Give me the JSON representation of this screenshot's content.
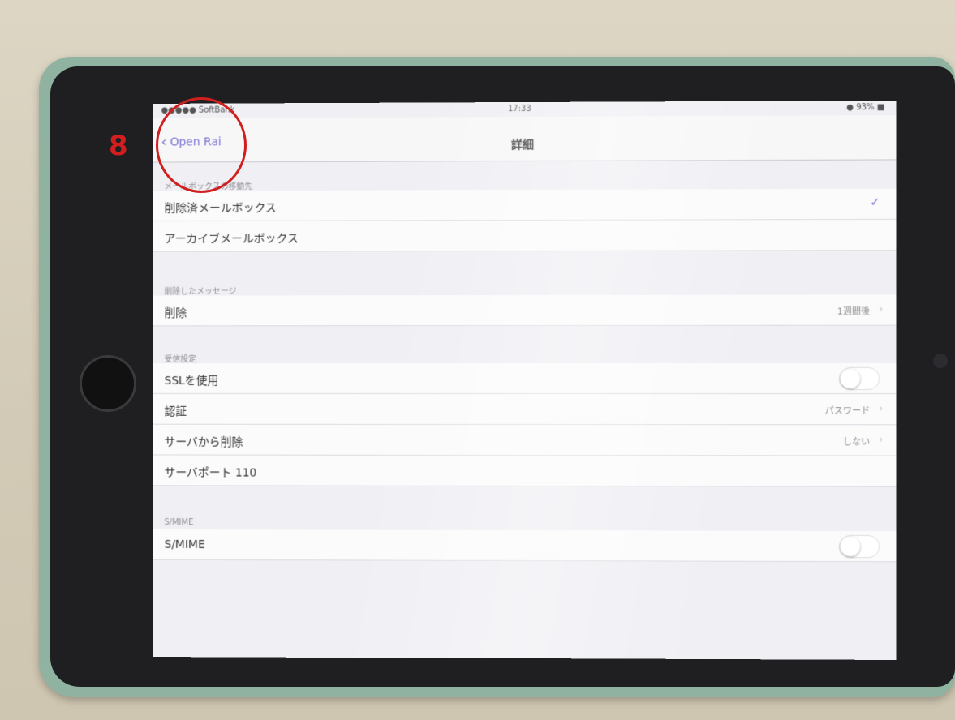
{
  "status_bar": {
    "carrier": "●●●●● SoftBank",
    "time": "17:33",
    "battery": "● 93% ■"
  },
  "nav": {
    "back_label": "Open Rai",
    "title": "詳細"
  },
  "sections": [
    {
      "header": "メールボックスの移動先",
      "rows": [
        {
          "label": "削除済メールボックス",
          "accessory": "check"
        },
        {
          "label": "アーカイブメールボックス",
          "accessory": "none"
        }
      ]
    },
    {
      "header": "削除したメッセージ",
      "rows": [
        {
          "label": "削除",
          "value": "1週間後",
          "accessory": "chevron"
        }
      ]
    },
    {
      "header": "受信設定",
      "rows": [
        {
          "label": "SSLを使用",
          "accessory": "toggle-off"
        },
        {
          "label": "認証",
          "value": "パスワード",
          "accessory": "chevron"
        },
        {
          "label": "サーバから削除",
          "value": "しない",
          "accessory": "chevron"
        },
        {
          "label": "サーバポート  110",
          "accessory": "none"
        }
      ]
    },
    {
      "header": "S/MIME",
      "rows": [
        {
          "label": "S/MIME",
          "accessory": "toggle-off"
        }
      ]
    }
  ],
  "annotation": {
    "step_number": "8"
  },
  "colors": {
    "accent": "#7a73d6",
    "annotation": "#d11f1f"
  },
  "icons": {
    "back": "chevron-left-icon",
    "check": "checkmark-icon",
    "chevron": "chevron-right-icon"
  }
}
